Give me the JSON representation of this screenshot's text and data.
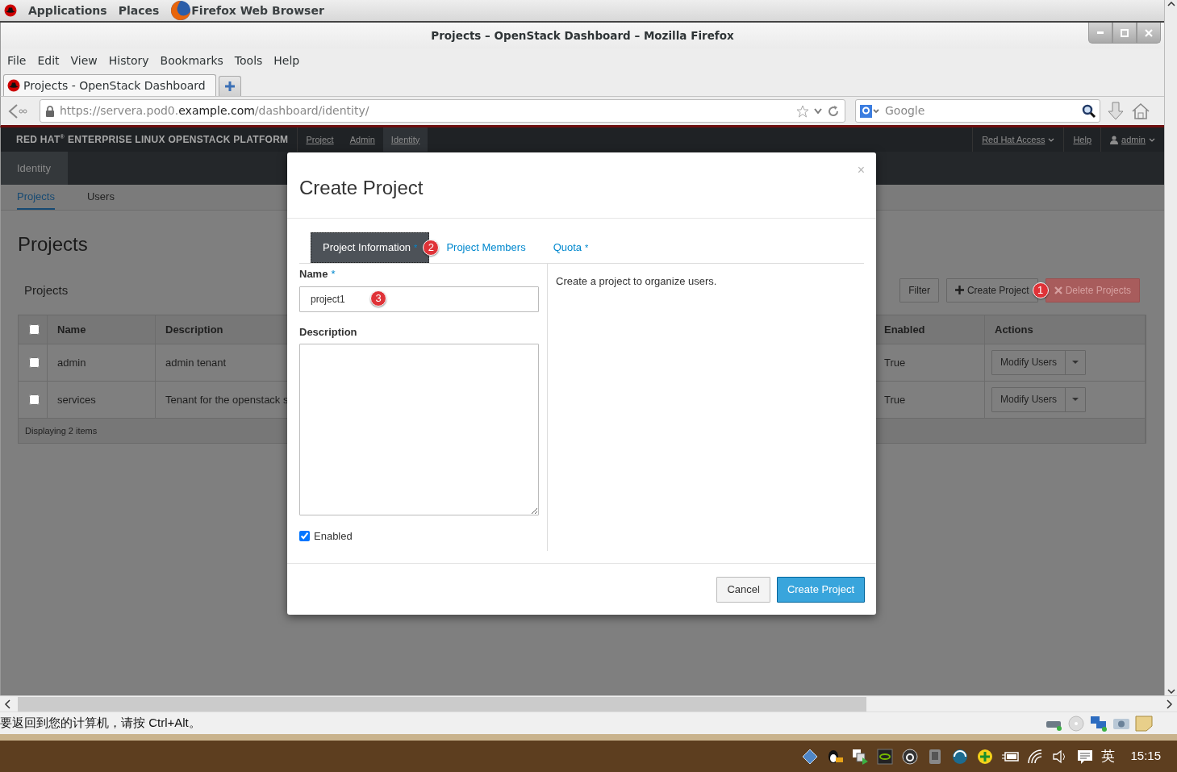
{
  "desktop_bar": {
    "items": [
      "Applications",
      "Places",
      "Firefox Web Browser"
    ]
  },
  "window": {
    "title": "Projects – OpenStack Dashboard – Mozilla Firefox"
  },
  "menu": [
    "File",
    "Edit",
    "View",
    "History",
    "Bookmarks",
    "Tools",
    "Help"
  ],
  "browser_tabs": [
    {
      "label": "Projects - OpenStack Dashboard",
      "selected": true
    }
  ],
  "address_bar": {
    "prefix": "https://servera.pod0.",
    "domain": "example.com",
    "path": "/dashboard/identity/"
  },
  "search_bar": {
    "placeholder": "Google"
  },
  "dashboard": {
    "brand": "RED HAT$^{®}$ ENTERPRISE LINUX OPENSTACK PLATFORM",
    "top_nav": [
      {
        "label": "Project",
        "selected": false
      },
      {
        "label": "Admin",
        "selected": false
      },
      {
        "label": "Identity",
        "selected": true
      }
    ],
    "user_nav": [
      {
        "label": "Red Hat Access",
        "kind": "menu"
      },
      {
        "label": "Help",
        "kind": "link"
      },
      {
        "label": "admin",
        "kind": "user"
      }
    ],
    "panel": {
      "label": "Identity"
    },
    "sub_nav": [
      {
        "label": "Projects",
        "selected": true
      },
      {
        "label": "Users",
        "selected": false
      }
    ],
    "page_title": "Projects",
    "table": {
      "title": "Projects",
      "actions": [
        {
          "label": "Filter",
          "kind": "filter",
          "disabled": false
        },
        {
          "label": "Create Project",
          "kind": "create",
          "disabled": false,
          "annotation": "1"
        },
        {
          "label": "Delete Projects",
          "kind": "delete",
          "disabled": true
        }
      ],
      "select_all": {
        "checked": false
      },
      "columns": [
        "Name",
        "Description",
        "Enabled",
        "Actions"
      ],
      "rows": [
        {
          "checked": false,
          "name": "admin",
          "description": "admin tenant",
          "enabled": "True",
          "action": "Modify Users"
        },
        {
          "checked": false,
          "name": "services",
          "description": "Tenant for the openstack s",
          "enabled": "True",
          "action": "Modify Users"
        }
      ],
      "footer": "Displaying 2 items"
    }
  },
  "modal": {
    "title": "Create Project",
    "close": "×",
    "tabs": [
      {
        "label": "Project Information",
        "required_mark": "*",
        "selected": true,
        "annotation": "2"
      },
      {
        "label": "Project Members",
        "selected": false
      },
      {
        "label": "Quota",
        "required_mark": "*",
        "selected": false
      }
    ],
    "name_field": {
      "label": "Name",
      "required_mark": "*",
      "value": "project1",
      "annotation": "3"
    },
    "description_field": {
      "label": "Description"
    },
    "enabled": {
      "label": "Enabled",
      "checked": true
    },
    "help": "Create a project to organize users.",
    "buttons": [
      {
        "label": "Cancel",
        "kind": "default"
      },
      {
        "label": "Create Project",
        "kind": "primary"
      }
    ]
  },
  "status_bar": {
    "message": "要返回到您的计算机，请按 Ctrl+Alt。"
  },
  "taskbar": {
    "input_method": "英",
    "clock": "15:15"
  }
}
